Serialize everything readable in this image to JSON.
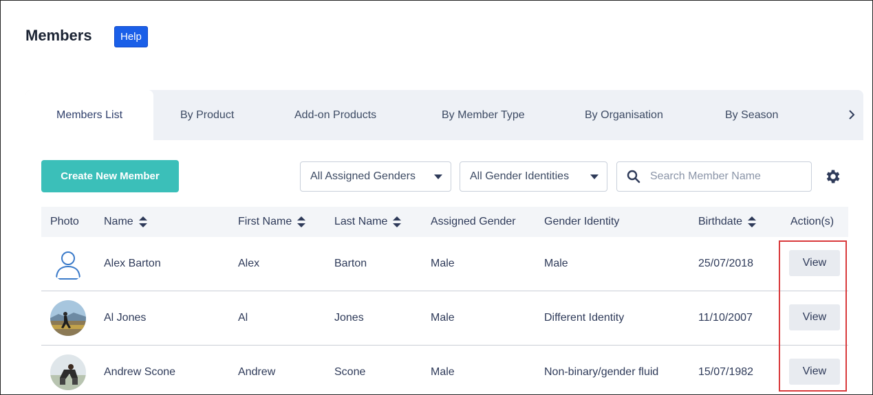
{
  "page": {
    "title": "Members",
    "help_label": "Help"
  },
  "tabs": [
    {
      "label": "Members List",
      "active": true
    },
    {
      "label": "By Product"
    },
    {
      "label": "Add-on Products"
    },
    {
      "label": "By Member Type"
    },
    {
      "label": "By Organisation"
    },
    {
      "label": "By Season"
    }
  ],
  "tabs_scroll_icon": "chevron-right-icon",
  "toolbar": {
    "create_label": "Create New Member",
    "assigned_gender_filter": "All Assigned Genders",
    "gender_identity_filter": "All Gender Identities",
    "search_placeholder": "Search Member Name",
    "settings_icon": "gear-icon"
  },
  "table": {
    "columns": [
      "Photo",
      "Name",
      "First Name",
      "Last Name",
      "Assigned Gender",
      "Gender Identity",
      "Birthdate",
      "Action(s)"
    ],
    "rows": [
      {
        "name": "Alex Barton",
        "first": "Alex",
        "last": "Barton",
        "assigned": "Male",
        "identity": "Male",
        "birthdate": "25/07/2018",
        "action": "View",
        "photo": "default-user-icon"
      },
      {
        "name": "Al Jones",
        "first": "Al",
        "last": "Jones",
        "assigned": "Male",
        "identity": "Different Identity",
        "birthdate": "11/10/2007",
        "action": "View",
        "photo": "runner-photo"
      },
      {
        "name": "Andrew Scone",
        "first": "Andrew",
        "last": "Scone",
        "assigned": "Male",
        "identity": "Non-binary/gender fluid",
        "birthdate": "15/07/1982",
        "action": "View",
        "photo": "sprinter-photo"
      }
    ]
  },
  "colors": {
    "accent": "#3bbfb9",
    "help": "#1a5fe8",
    "highlight": "#d9393b"
  }
}
